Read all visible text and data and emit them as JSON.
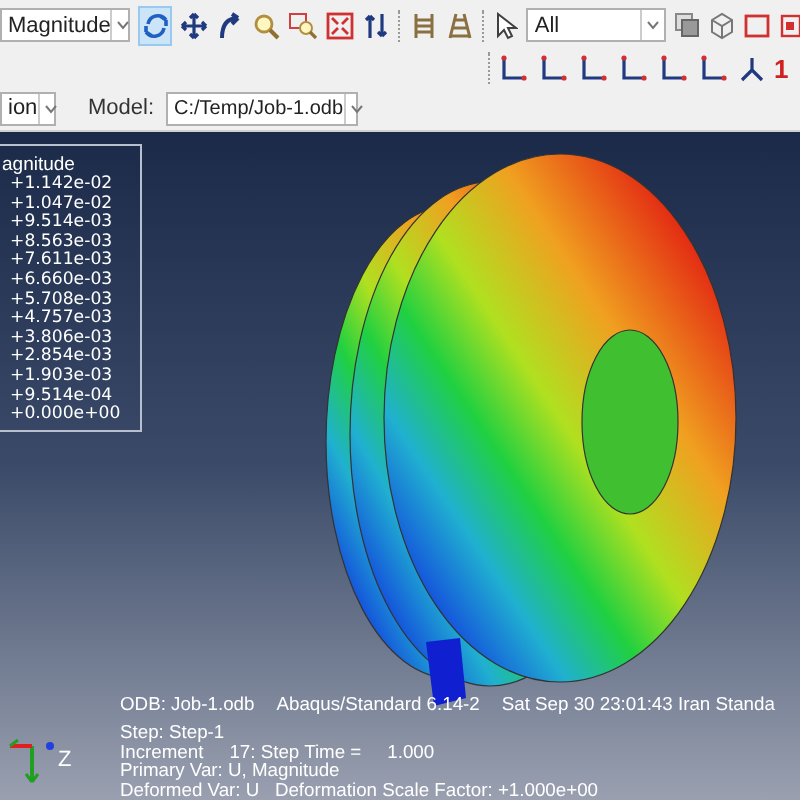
{
  "toolbar": {
    "result_field": "Magnitude",
    "sync_selected": true,
    "selection_filter": "All",
    "view_number": "1"
  },
  "context_bar": {
    "module_field": "ion",
    "model_label": "Model:",
    "model_field": "C:/Temp/Job-1.odb"
  },
  "viewport": {
    "legend": {
      "title": "agnitude",
      "values": [
        "+1.142e-02",
        "+1.047e-02",
        "+9.514e-03",
        "+8.563e-03",
        "+7.611e-03",
        "+6.660e-03",
        "+5.708e-03",
        "+4.757e-03",
        "+3.806e-03",
        "+2.854e-03",
        "+1.903e-03",
        "+9.514e-04",
        "+0.000e+00"
      ]
    },
    "info": {
      "odb": "ODB: Job-1.odb",
      "solver": "Abaqus/Standard 6.14-2",
      "date": "Sat Sep 30 23:01:43 Iran Standa",
      "lines": [
        "Step: Step-1",
        "Increment     17: Step Time =     1.000",
        "Primary Var: U, Magnitude",
        "Deformed Var: U   Deformation Scale Factor: +1.000e+00"
      ]
    },
    "triad_label": "Z"
  }
}
